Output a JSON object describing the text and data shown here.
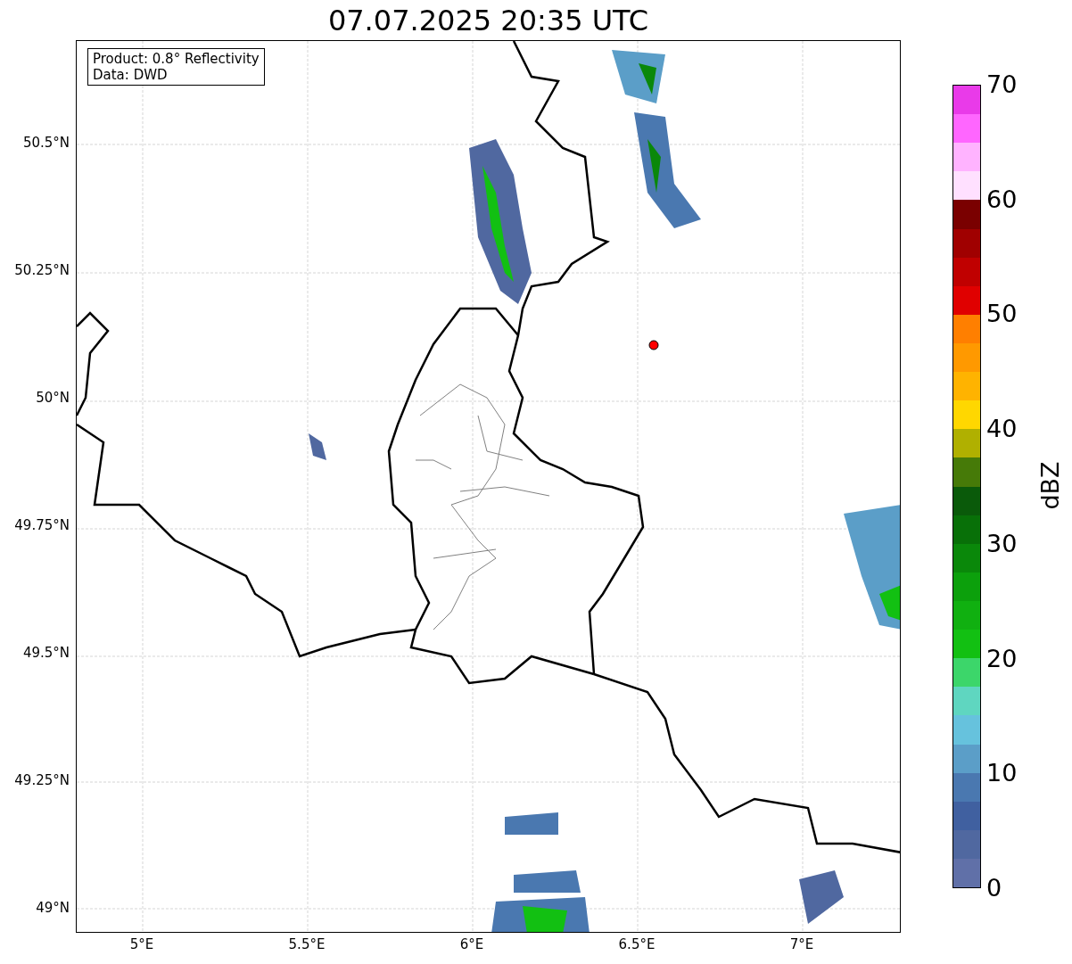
{
  "title": "07.07.2025 20:35 UTC",
  "map": {
    "info_box": [
      "Product: 0.8° Reflectivity",
      "Data: DWD"
    ],
    "lat_ticks": [
      "50.5°N",
      "50.25°N",
      "50°N",
      "49.75°N",
      "49.5°N",
      "49.25°N",
      "49°N"
    ],
    "lon_ticks": [
      "5°E",
      "5.5°E",
      "6°E",
      "6.5°E",
      "7°E"
    ]
  },
  "colorbar": {
    "ticks": [
      "70",
      "60",
      "50",
      "40",
      "30",
      "20",
      "10",
      "0"
    ],
    "levels": [
      {
        "color": "#e93ae9"
      },
      {
        "color": "#ff66ff"
      },
      {
        "color": "#ffb3ff"
      },
      {
        "color": "#ffe0ff"
      },
      {
        "color": "#7a0000"
      },
      {
        "color": "#a00000"
      },
      {
        "color": "#c00000"
      },
      {
        "color": "#e00000"
      },
      {
        "color": "#ff7f00"
      },
      {
        "color": "#ff9900"
      },
      {
        "color": "#ffb300"
      },
      {
        "color": "#ffd700"
      },
      {
        "color": "#b0b000"
      },
      {
        "color": "#467a08"
      },
      {
        "color": "#0a5a0a"
      },
      {
        "color": "#087008"
      },
      {
        "color": "#0a880a"
      },
      {
        "color": "#0ca00c"
      },
      {
        "color": "#10b010"
      },
      {
        "color": "#12c012"
      },
      {
        "color": "#3cd66a"
      },
      {
        "color": "#5fd6c0"
      },
      {
        "color": "#66c2dd"
      },
      {
        "color": "#5b9ec8"
      },
      {
        "color": "#4a78b0"
      },
      {
        "color": "#4060a0"
      },
      {
        "color": "#5068a0"
      },
      {
        "color": "#6070a8"
      }
    ],
    "label": "dBZ"
  }
}
